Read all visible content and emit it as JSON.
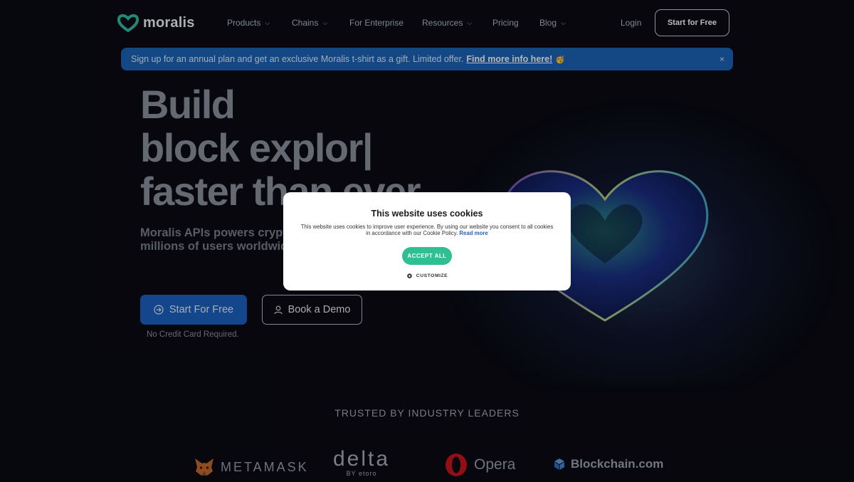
{
  "nav": {
    "logo_text": "moralis",
    "items": [
      {
        "label": "Products",
        "dropdown": true
      },
      {
        "label": "Chains",
        "dropdown": true
      },
      {
        "label": "For Enterprise",
        "dropdown": false
      },
      {
        "label": "Resources",
        "dropdown": true
      },
      {
        "label": "Pricing",
        "dropdown": false
      },
      {
        "label": "Blog",
        "dropdown": true
      }
    ],
    "login": "Login",
    "cta": "Start for Free"
  },
  "banner": {
    "text": "Sign up for an annual plan and get an exclusive Moralis t-shirt as a gift. Limited offer.",
    "link": "Find more info here!",
    "emoji": "🥳",
    "close": "×"
  },
  "hero": {
    "title_lines": [
      "Build",
      "block explor|",
      "faster than ever"
    ],
    "subtitle": "Moralis APIs powers cryptocurrency applications for millions of users worldwide.",
    "primary_button": "Start For Free",
    "secondary_button": "Book a Demo",
    "note": "No Credit Card Required."
  },
  "trusted": {
    "heading": "TRUSTED BY INDUSTRY LEADERS",
    "logos": {
      "metamask": "METAMASK",
      "delta": "delta",
      "delta_by": "BY",
      "delta_etoro": "etoro",
      "opera": "Opera",
      "blockchain": "Blockchain.com"
    }
  },
  "cookie": {
    "title": "This website uses cookies",
    "text": "This website uses cookies to improve user experience. By using our website you consent to all cookies in accordance with our Cookie Policy.",
    "read_more": "Read more",
    "accept": "ACCEPT ALL",
    "customize": "CUSTOMIZE"
  },
  "colors": {
    "background": "#0a0b12",
    "primary": "#1d62c2",
    "banner": "#1d64b8",
    "accept": "#2fbf92"
  }
}
